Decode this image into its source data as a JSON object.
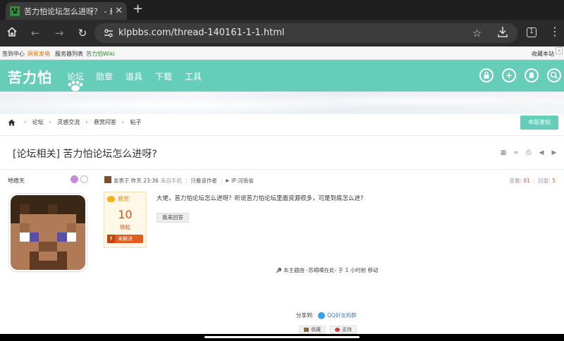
{
  "browser": {
    "tab_title": "苦力怕论坛怎么进呀？ - 悬赏",
    "url": "klpbbs.com/thread-140161-1-1.html",
    "tab_count": "1"
  },
  "site_topbar": {
    "links": [
      "签到中心",
      "网易发电",
      "服务器列表",
      "苦力怕Wiki"
    ],
    "right_text": "收藏本站"
  },
  "header": {
    "logo": "苦力怕",
    "nav": [
      "论坛",
      "勋章",
      "道具",
      "下载",
      "工具"
    ]
  },
  "breadcrumb": [
    "论坛",
    "灵感交流",
    "悬赏问答",
    "帖子"
  ],
  "post_button_label": "本版发帖",
  "thread": {
    "title": "[论坛相关] 苦力怕论坛怎么进呀?"
  },
  "author": {
    "name": "地痞天"
  },
  "meta": {
    "posted": "发表于 昨天 23:36",
    "from": "来自手机",
    "only_author": "只看该作者",
    "ip": "IP:河南省",
    "views_label": "查看:",
    "views": "81",
    "replies_label": "回复:",
    "replies": "5"
  },
  "reward": {
    "label": "悬赏",
    "amount": "10",
    "unit": "铁粒",
    "status": "未解决",
    "status_icon": "?"
  },
  "post": {
    "body": "大佬，苦力怕论坛怎么进呀？听说苦力怕论坛里面资源很多，可是到底怎么进?",
    "answer_button": "我来回答"
  },
  "moved_note": "本主题由 -苏嘀嘀在此- 于 1 小时前 移动",
  "share": {
    "label": "分享到:",
    "target": "QQ好友和群"
  },
  "bottom_buttons": [
    "收藏",
    "支持"
  ],
  "colors": {
    "brand": "#66cdb9",
    "accent_red": "#e05a3a",
    "reward_orange": "#e45b1e"
  }
}
